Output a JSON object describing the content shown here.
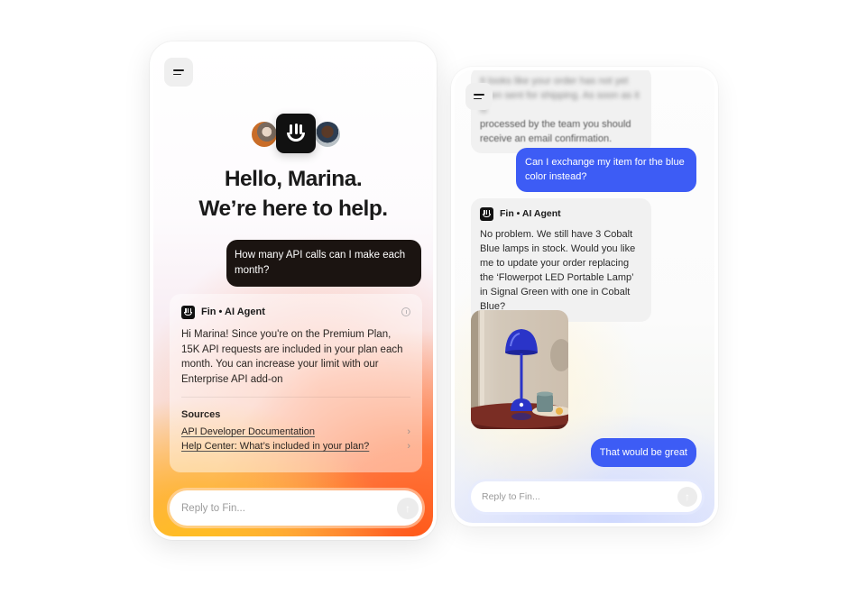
{
  "left_panel": {
    "menu_icon": "menu-icon",
    "avatars": [
      "team-member-avatar",
      "fin-logo",
      "team-member-avatar"
    ],
    "greeting_line1": "Hello, Marina.",
    "greeting_line2": "We’re here to help.",
    "user_message": "How many API calls can I make each month?",
    "agent": {
      "name": "Fin • AI Agent",
      "logo_icon": "fin-logo-icon",
      "info_icon": "info-icon",
      "message": "Hi Marina! Since you're on the Premium Plan, 15K API requests are included in your plan each month. You can increase your limit with our Enterprise API add-on",
      "sources_title": "Sources",
      "sources": [
        {
          "label": "API Developer Documentation",
          "icon": "chevron-right-icon"
        },
        {
          "label": "Help Center: What’s included in your plan?",
          "icon": "chevron-right-icon"
        }
      ]
    },
    "reply": {
      "placeholder": "Reply to Fin...",
      "send_icon": "arrow-up-icon"
    }
  },
  "right_panel": {
    "menu_icon": "menu-icon",
    "previous_agent_message_blurred": [
      "It looks like your order has not yet",
      "been sent for shipping. As soon as it is"
    ],
    "previous_agent_message_visible": [
      "processed by the team you should",
      "receive an email confirmation."
    ],
    "user_message_1": "Can I exchange my item for the blue color instead?",
    "agent": {
      "name": "Fin • AI Agent",
      "logo_icon": "fin-logo-icon",
      "message": "No problem. We still have 3 Cobalt Blue lamps in stock. Would you like me to  update your order replacing the ‘Flowerpot LED Portable Lamp’ in Signal Green with one in Cobalt Blue?"
    },
    "image_alt": "Cobalt Blue Flowerpot LED Portable Lamp",
    "user_message_2": "That would be great",
    "reply": {
      "placeholder": "Reply to Fin...",
      "send_icon": "arrow-up-icon"
    }
  },
  "colors": {
    "user_bubble_dark": "#1b1411",
    "user_bubble_blue": "#3d5cf5",
    "gradient_orange": "#ff5a1a",
    "gradient_yellow": "#ffc21a"
  }
}
